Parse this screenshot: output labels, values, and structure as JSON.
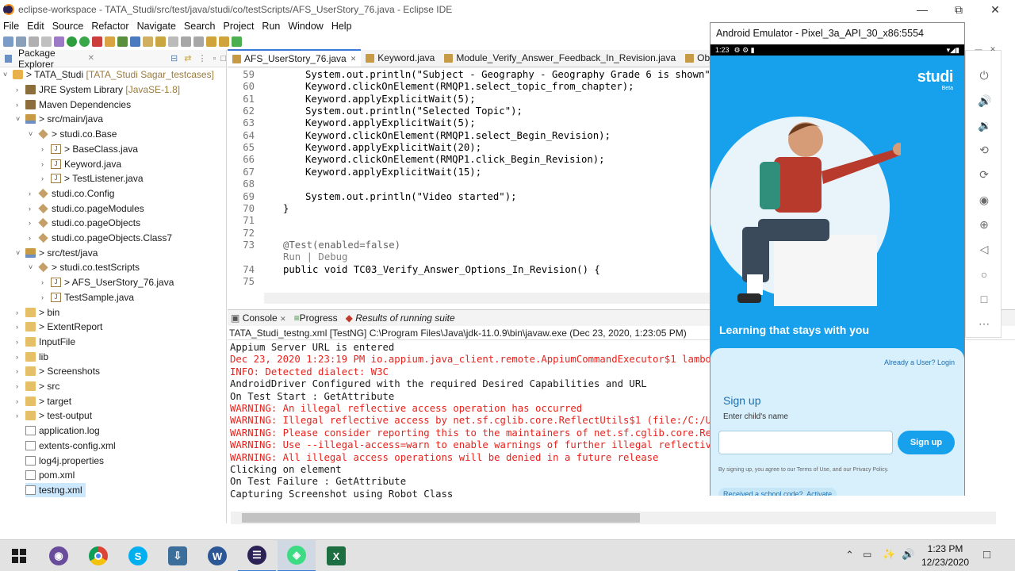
{
  "window": {
    "title": "eclipse-workspace - TATA_Studi/src/test/java/studi/co/testScripts/AFS_UserStory_76.java - Eclipse IDE"
  },
  "menu": [
    "File",
    "Edit",
    "Source",
    "Refactor",
    "Navigate",
    "Search",
    "Project",
    "Run",
    "Window",
    "Help"
  ],
  "package_explorer": {
    "title": "Package Explorer",
    "items": [
      {
        "label": "> TATA_Studi",
        "decoration": "[TATA_Studi Sagar_testcases]"
      },
      {
        "label": "JRE System Library",
        "decoration": "[JavaSE-1.8]"
      },
      {
        "label": "Maven Dependencies",
        "decoration": ""
      },
      {
        "label": "> src/main/java",
        "decoration": ""
      },
      {
        "label": "> studi.co.Base",
        "decoration": ""
      },
      {
        "label": "> BaseClass.java",
        "decoration": ""
      },
      {
        "label": "Keyword.java",
        "decoration": ""
      },
      {
        "label": "> TestListener.java",
        "decoration": ""
      },
      {
        "label": "studi.co.Config",
        "decoration": ""
      },
      {
        "label": "studi.co.pageModules",
        "decoration": ""
      },
      {
        "label": "studi.co.pageObjects",
        "decoration": ""
      },
      {
        "label": "studi.co.pageObjects.Class7",
        "decoration": ""
      },
      {
        "label": "> src/test/java",
        "decoration": ""
      },
      {
        "label": "> studi.co.testScripts",
        "decoration": ""
      },
      {
        "label": "> AFS_UserStory_76.java",
        "decoration": ""
      },
      {
        "label": "TestSample.java",
        "decoration": ""
      },
      {
        "label": "> bin",
        "decoration": ""
      },
      {
        "label": "> ExtentReport",
        "decoration": ""
      },
      {
        "label": "InputFile",
        "decoration": ""
      },
      {
        "label": "lib",
        "decoration": ""
      },
      {
        "label": "> Screenshots",
        "decoration": ""
      },
      {
        "label": "> src",
        "decoration": ""
      },
      {
        "label": "> target",
        "decoration": ""
      },
      {
        "label": "> test-output",
        "decoration": ""
      },
      {
        "label": "application.log",
        "decoration": ""
      },
      {
        "label": "extents-config.xml",
        "decoration": ""
      },
      {
        "label": "log4j.properties",
        "decoration": ""
      },
      {
        "label": "pom.xml",
        "decoration": ""
      },
      {
        "label": "testng.xml",
        "decoration": ""
      }
    ]
  },
  "editor": {
    "tabs": [
      "AFS_UserStory_76.java",
      "Keyword.java",
      "Module_Verify_Answer_Feedback_In_Revision.java",
      "Object_R"
    ],
    "line_numbers": [
      "59",
      "60",
      "61",
      "62",
      "63",
      "64",
      "65",
      "66",
      "67",
      "68",
      "69",
      "70",
      "71",
      "72",
      "73",
      "",
      "74",
      "75"
    ],
    "lines": [
      "System.out.println(\"Subject - Geography - Geography Grade 6 is shown\");",
      "Keyword.clickOnElement(RMQP1.select_topic_from_chapter);",
      "Keyword.applyExplicitWait(5);",
      "System.out.println(\"Selected Topic\");",
      "Keyword.applyExplicitWait(5);",
      "Keyword.clickOnElement(RMQP1.select_Begin_Revision);",
      "Keyword.applyExplicitWait(20);",
      "Keyword.clickOnElement(RMQP1.click_Begin_Revision);",
      "Keyword.applyExplicitWait(15);",
      "",
      "System.out.println(\"Video started\");",
      "}",
      "",
      "",
      "@Test(enabled=false)",
      "Run | Debug",
      "public void TC03_Verify_Answer_Options_In_Revision() {",
      ""
    ]
  },
  "console": {
    "tabs": [
      "Console",
      "Progress",
      "Results of running suite"
    ],
    "info": "TATA_Studi_testng.xml [TestNG] C:\\Program Files\\Java\\jdk-11.0.9\\bin\\javaw.exe  (Dec 23, 2020, 1:23:05 PM)",
    "lines": [
      {
        "text": "Appium Server URL is entered",
        "error": false
      },
      {
        "text": "Dec 23, 2020 1:23:19 PM io.appium.java_client.remote.AppiumCommandExecutor$1 lambda$0",
        "error": true
      },
      {
        "text": "INFO: Detected dialect: W3C",
        "error": true
      },
      {
        "text": "AndroidDriver Configured with the required Desired Capabilities and URL",
        "error": false
      },
      {
        "text": "On Test Start : GetAttribute",
        "error": false
      },
      {
        "text": "WARNING: An illegal reflective access operation has occurred",
        "error": true
      },
      {
        "text": "WARNING: Illegal reflective access by net.sf.cglib.core.ReflectUtils$1 (file:/C:/Users/ ... /cglib-3.",
        "error": true
      },
      {
        "text": "WARNING: Please consider reporting this to the maintainers of net.sf.cglib.core.ReflectUtils$1",
        "error": true
      },
      {
        "text": "WARNING: Use --illegal-access=warn to enable warnings of further illegal reflective access operations",
        "error": true
      },
      {
        "text": "WARNING: All illegal access operations will be denied in a future release",
        "error": true
      },
      {
        "text": "Clicking on element",
        "error": false
      },
      {
        "text": "On Test Failure : GetAttribute",
        "error": false
      },
      {
        "text": "Capturing Screenshot using Robot Class",
        "error": false
      }
    ]
  },
  "emulator": {
    "title": "Android Emulator - Pixel_3a_API_30_x86:5554",
    "status_time": "1:23",
    "app": {
      "logo": "studi",
      "logo_sub": "Beta",
      "tagline": "Learning that stays with you",
      "already_user": "Already a User? Login",
      "signup_title": "Sign up",
      "name_label": "Enter child's name",
      "name_placeholder": "",
      "signup_button": "Sign up",
      "terms": "By signing up, you agree to our Terms of Use, and our Privacy Policy.",
      "school_code": "Received a school code?, Activate"
    }
  },
  "taskbar": {
    "time": "1:23 PM",
    "date": "12/23/2020"
  }
}
